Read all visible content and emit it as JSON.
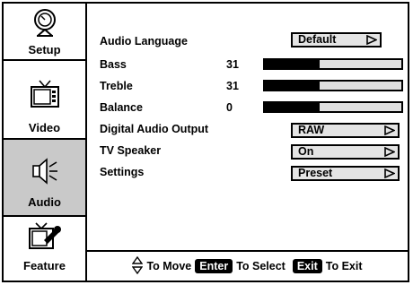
{
  "sidebar": {
    "items": [
      {
        "label": "Setup",
        "icon": "setup-dial-icon"
      },
      {
        "label": "Video",
        "icon": "tv-icon"
      },
      {
        "label": "Audio",
        "icon": "speaker-icon",
        "active": true
      },
      {
        "label": "Feature",
        "icon": "tv-wrench-icon"
      }
    ]
  },
  "audio": {
    "language": {
      "label": "Audio Language",
      "value": "Default"
    },
    "bass": {
      "label": "Bass",
      "value": "31",
      "level": 0.4
    },
    "treble": {
      "label": "Treble",
      "value": "31",
      "level": 0.4
    },
    "balance": {
      "label": "Balance",
      "value": "0",
      "level": 0.4
    },
    "digital_output": {
      "label": "Digital Audio Output",
      "value": "RAW"
    },
    "tv_speaker": {
      "label": "TV Speaker",
      "value": "On"
    },
    "settings": {
      "label": "Settings",
      "value": "Preset"
    }
  },
  "footer": {
    "move_text": "To Move",
    "enter_key": "Enter",
    "select_text": "To Select",
    "exit_key": "Exit",
    "exit_text": "To Exit"
  },
  "colors": {
    "active_tab": "#c9c9c9",
    "bar_track": "#e0e0e0",
    "select_bg": "#e4e4e4"
  }
}
